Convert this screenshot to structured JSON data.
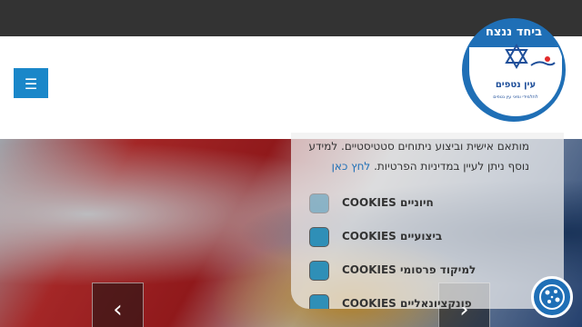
{
  "header": {
    "menu_icon": "☰",
    "logo": {
      "top_text": "ביחד ננצח",
      "name": "עין נטפים",
      "subtitle": "לתלמידי ומיני עין נטפים"
    }
  },
  "slider": {
    "prev_icon": "chevron-left-icon",
    "next_icon": "chevron-right-icon",
    "prev_glyph": "‹",
    "next_glyph": "›"
  },
  "cookie_consent": {
    "text_line1": "מותאם אישית וביצוע ניתוחים סטטיסטיים. למידע",
    "text_line2": "נוסף ניתן לעיין במדיניות הפרטיות.",
    "link_text": "לחץ כאן",
    "categories": [
      {
        "label": "חיוניים COOKIES",
        "enabled": false
      },
      {
        "label": "ביצועיים COOKIES",
        "enabled": true
      },
      {
        "label": "למיקוד פרסומי COOKIES",
        "enabled": true
      },
      {
        "label": "פונקציונאליים COOKIES",
        "enabled": true
      }
    ]
  },
  "colors": {
    "accent": "#1a87c9",
    "logo_blue": "#1f6fb6",
    "topbar": "#333333"
  },
  "cookie_button": {
    "icon": "cookie-icon"
  }
}
